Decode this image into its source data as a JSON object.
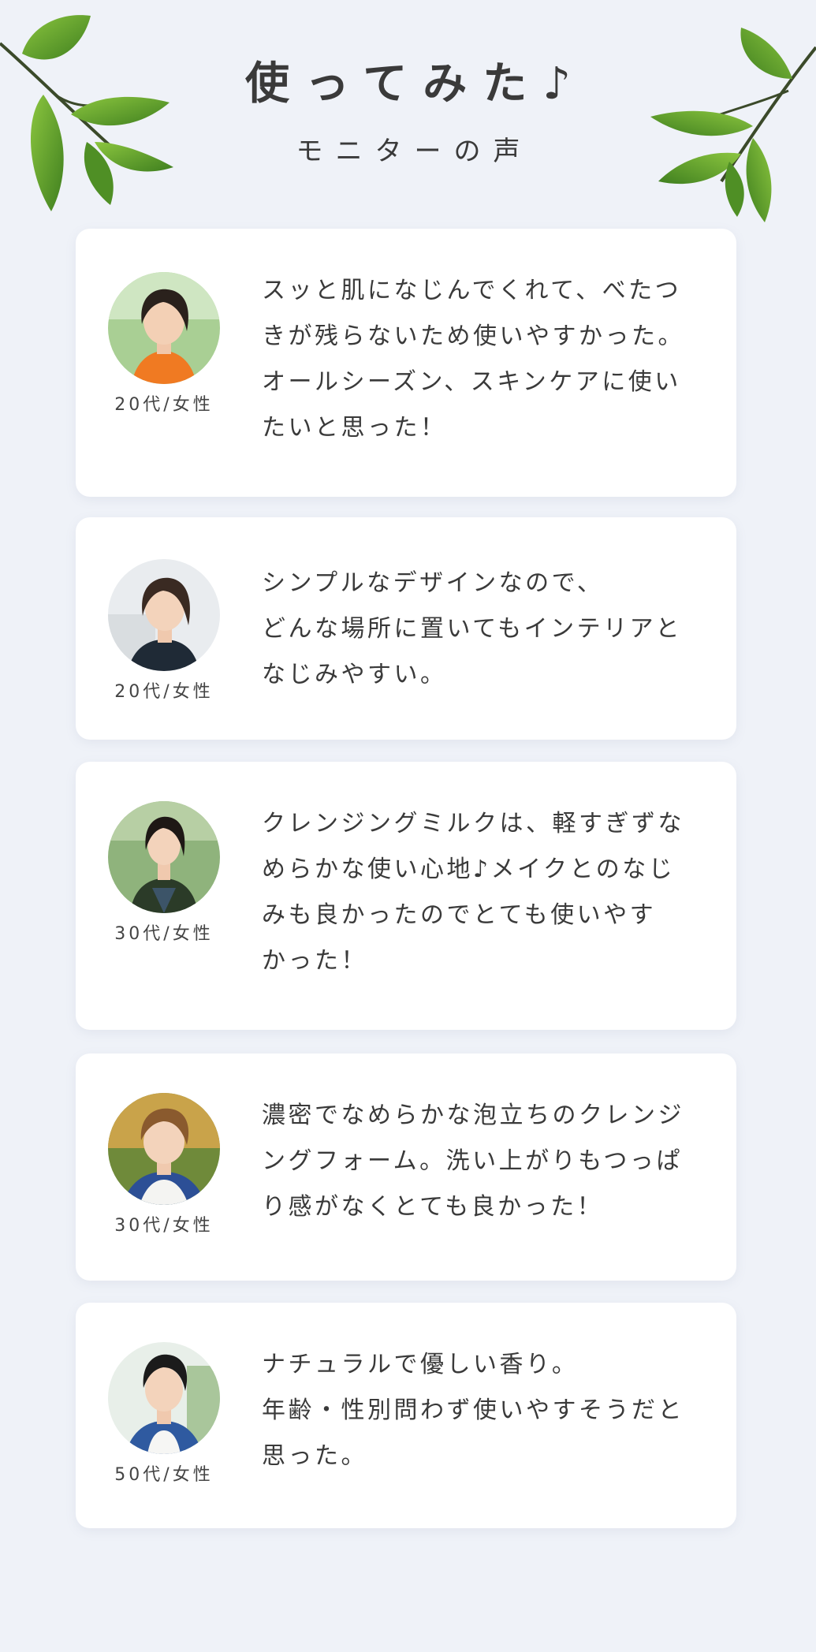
{
  "header": {
    "title": "使ってみた♪",
    "subtitle": "モニターの声"
  },
  "colors": {
    "background": "#eff2f8",
    "card": "#ffffff",
    "text": "#3a3a3a",
    "leaf": "#5a9a2c"
  },
  "icons": {
    "left_decoration": "leaf-branch-icon",
    "right_decoration": "leaf-branch-icon"
  },
  "reviews": [
    {
      "age": "20代/女性",
      "lines": [
        "スッと肌になじんでくれて、べたつ",
        "きが残らないため使いやすかった。",
        "オールシーズン、スキンケアに使い",
        "たいと思った！"
      ]
    },
    {
      "age": "20代/女性",
      "lines": [
        "シンプルなデザインなので、",
        "どんな場所に置いてもインテリアと",
        "なじみやすい。"
      ]
    },
    {
      "age": "30代/女性",
      "lines": [
        "クレンジングミルクは、軽すぎずな",
        "めらかな使い心地♪メイクとのなじ",
        "みも良かったのでとても使いやす",
        "かった！"
      ]
    },
    {
      "age": "30代/女性",
      "lines": [
        "濃密でなめらかな泡立ちのクレンジ",
        "ングフォーム。洗い上がりもつっぱ",
        "り感がなくとても良かった！"
      ]
    },
    {
      "age": "50代/女性",
      "lines": [
        "ナチュラルで優しい香り。",
        "年齢・性別問わず使いやすそうだと",
        "思った。"
      ]
    }
  ]
}
